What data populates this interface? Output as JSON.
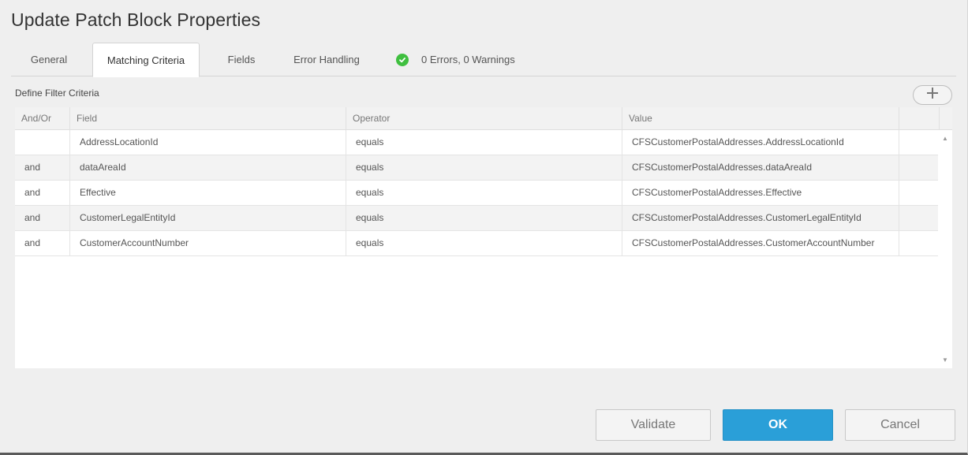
{
  "dialog": {
    "title": "Update Patch Block Properties"
  },
  "tabs": [
    {
      "label": "General",
      "active": false
    },
    {
      "label": "Matching Criteria",
      "active": true
    },
    {
      "label": "Fields",
      "active": false
    },
    {
      "label": "Error Handling",
      "active": false
    }
  ],
  "status": {
    "text": "0 Errors, 0 Warnings",
    "icon": "check-circle-icon",
    "color": "#3fbf3f"
  },
  "section": {
    "label": "Define Filter Criteria",
    "add_icon": "plus-icon"
  },
  "grid": {
    "columns": [
      "And/Or",
      "Field",
      "Operator",
      "Value",
      ""
    ],
    "rows": [
      {
        "andor": "",
        "field": "AddressLocationId",
        "operator": "equals",
        "value": "CFSCustomerPostalAddresses.AddressLocationId"
      },
      {
        "andor": "and",
        "field": "dataAreaId",
        "operator": "equals",
        "value": "CFSCustomerPostalAddresses.dataAreaId"
      },
      {
        "andor": "and",
        "field": "Effective",
        "operator": "equals",
        "value": "CFSCustomerPostalAddresses.Effective"
      },
      {
        "andor": "and",
        "field": "CustomerLegalEntityId",
        "operator": "equals",
        "value": "CFSCustomerPostalAddresses.CustomerLegalEntityId"
      },
      {
        "andor": "and",
        "field": "CustomerAccountNumber",
        "operator": "equals",
        "value": "CFSCustomerPostalAddresses.CustomerAccountNumber"
      }
    ]
  },
  "buttons": {
    "validate": "Validate",
    "ok": "OK",
    "cancel": "Cancel"
  },
  "colors": {
    "primary": "#2a9fd8",
    "background": "#efefef"
  }
}
